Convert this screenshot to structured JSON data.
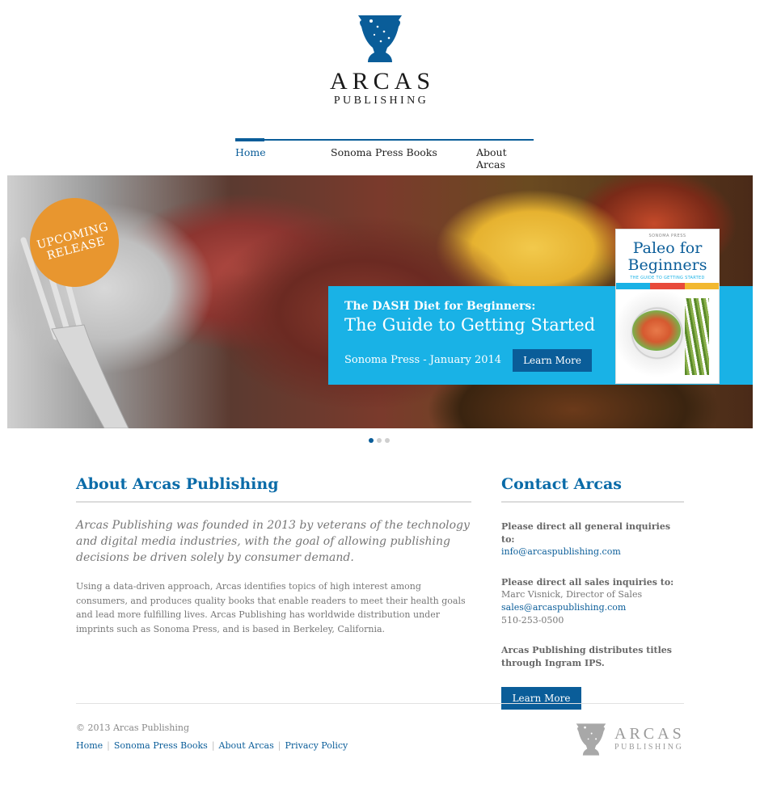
{
  "brand": {
    "name": "ARCAS",
    "sub": "PUBLISHING",
    "primary_color": "#0a5d99",
    "accent_color": "#19b2e6",
    "badge_color": "#e8962f",
    "logo_icon": "urn-icon"
  },
  "nav": {
    "items": [
      {
        "label": "Home",
        "active": true
      },
      {
        "label": "Sonoma Press Books",
        "active": false
      },
      {
        "label": "About Arcas",
        "active": false
      }
    ]
  },
  "hero": {
    "badge_line1": "UPCOMING",
    "badge_line2": "RELEASE",
    "kicker": "The DASH Diet for Beginners:",
    "title": "The Guide to Getting Started",
    "meta": "Sonoma Press - January 2014",
    "button": "Learn More",
    "book": {
      "press": "SONOMA PRESS",
      "title_line1": "Paleo for",
      "title_line2": "Beginners",
      "subtitle": "THE GUIDE TO GETTING STARTED"
    },
    "slides": 3,
    "active_slide": 1
  },
  "about": {
    "heading": "About Arcas Publishing",
    "lead": "Arcas Publishing was founded in 2013 by veterans of the technology and digital media industries, with the goal of allowing publishing decisions be driven solely by consumer demand.",
    "body": "Using a data-driven approach, Arcas identifies topics of high interest among consumers, and produces quality books that enable readers to meet their health goals and lead more fulfilling lives. Arcas Publishing has worldwide distribution under imprints such as Sonoma Press, and is based in Berkeley, California."
  },
  "contact": {
    "heading": "Contact Arcas",
    "general_label": "Please direct all general inquiries to:",
    "general_email": "info@arcaspublishing.com",
    "sales_label": "Please direct all sales inquiries to:",
    "sales_name": "Marc Visnick, Director of Sales",
    "sales_email": "sales@arcaspublishing.com",
    "sales_phone": "510-253-0500",
    "distribution": "Arcas Publishing distributes titles through Ingram IPS.",
    "button": "Learn More"
  },
  "footer": {
    "copyright": "© 2013 Arcas Publishing",
    "links": [
      "Home",
      "Sonoma Press Books",
      "About Arcas",
      "Privacy Policy"
    ],
    "logo_word": "ARCAS",
    "logo_sub": "PUBLISHING"
  }
}
